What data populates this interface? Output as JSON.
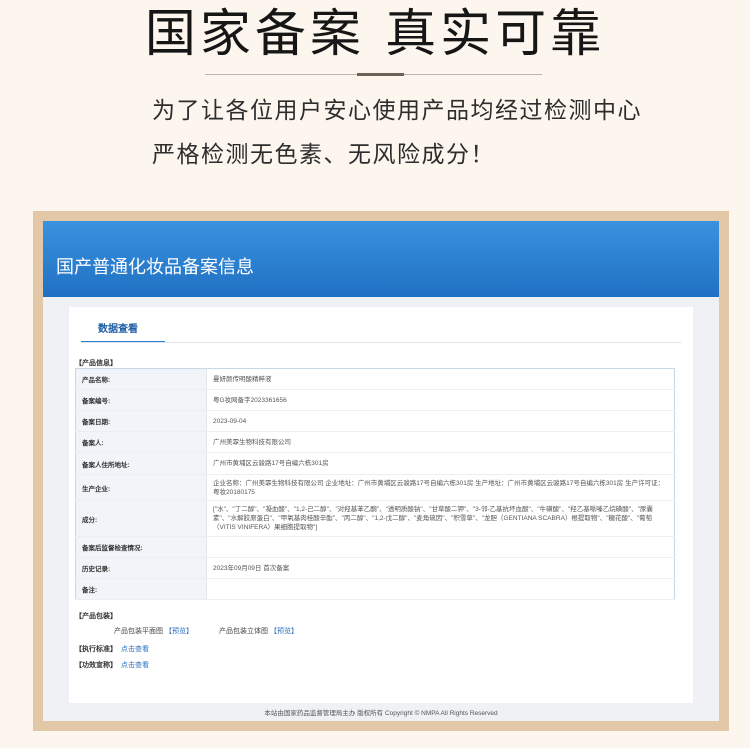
{
  "promo": {
    "headline": "国家备案 真实可靠",
    "sub_line1": "为了让各位用户安心使用产品均经过检测中心",
    "sub_line2": "严格检测无色素、无风险成分！"
  },
  "site": {
    "banner_title": "国产普通化妆品备案信息",
    "tab_label": "数据查看",
    "footer": "本站由国家药品监督管理局主办 版权所有 Copyright © NMPA All Rights Reserved"
  },
  "product_info": {
    "section_title": "【产品信息】",
    "rows": [
      {
        "label": "产品名称:",
        "value": "曼妍颜传明酸精粹液"
      },
      {
        "label": "备案编号:",
        "value": "粤G妆网备字2023361656"
      },
      {
        "label": "备案日期:",
        "value": "2023-09-04"
      },
      {
        "label": "备案人:",
        "value": "广州美霏生物科技有限公司"
      },
      {
        "label": "备案人住所地址:",
        "value": "广州市黄埔区云骏路17号自编六栋301房"
      },
      {
        "label": "生产企业:",
        "value": "企业名称：广州美霏生物科技有限公司 企业地址：广州市黄埔区云骏路17号自编六栋301房 生产地址：广州市黄埔区云骏路17号自编六栋301房 生产许可证：粤妆20180175"
      },
      {
        "label": "成分:",
        "value": "[\"水\"、\"丁二醇\"、\"凝血酸\"、\"1,2-己二醇\"、\"对羟基苯乙酮\"、\"透明质酸钠\"、\"甘草酸二钾\"、\"3-邻-乙基抗坏血酸\"、\"牛磺酸\"、\"羟乙基哌嗪乙烷磺酸\"、\"尿囊素\"、\"水解胶原蛋白\"、\"甲氧基肉桂酸辛酯\"、\"丙二醇\"、\"1,2-戊二醇\"、\"麦角硫因\"、\"积雪草\"、\"龙胆（GENTIANA SCABRA）根提取物\"、\"糖花酸\"、\"葡萄（VITIS VINIFERA）果细胞提取物\"]"
      },
      {
        "label": "备案后监督检查情况:",
        "value": ""
      },
      {
        "label": "历史记录:",
        "value": "2023年09月09日 首次备案"
      },
      {
        "label": "备注:",
        "value": ""
      }
    ]
  },
  "packaging": {
    "section_title": "【产品包装】",
    "flat_label": "产品包装平面图",
    "flat_link": "【预览】",
    "solid_label": "产品包装立体图",
    "solid_link": "【预览】"
  },
  "standard": {
    "section_title": "【执行标准】",
    "link": "点击查看"
  },
  "efficacy": {
    "section_title": "【功效宣称】",
    "link": "点击查看"
  }
}
